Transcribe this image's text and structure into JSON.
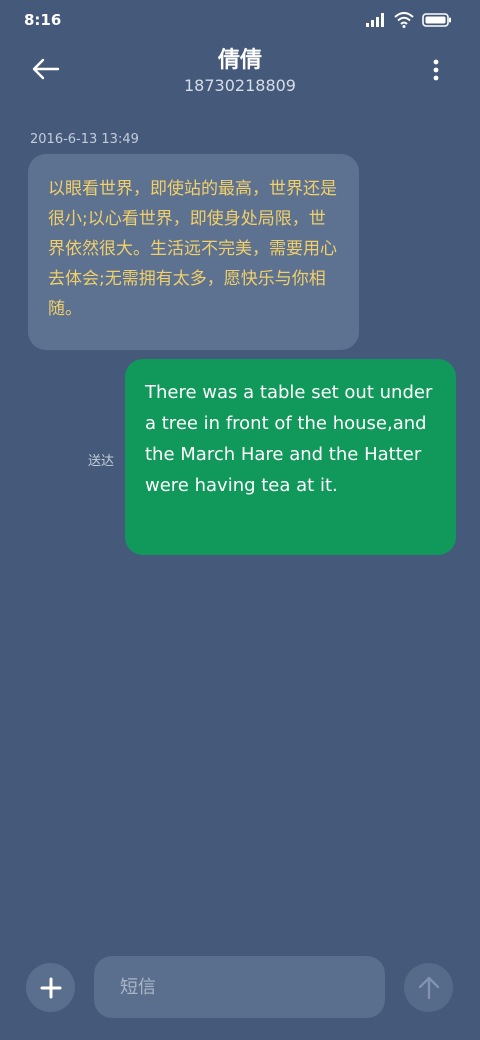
{
  "status_bar": {
    "time": "8:16",
    "icons": [
      "signal-icon",
      "wifi-icon",
      "battery-icon"
    ]
  },
  "header": {
    "back_icon": "back-arrow-icon",
    "contact_name": "倩倩",
    "contact_number": "18730218809",
    "menu_icon": "more-vertical-icon"
  },
  "conversation": {
    "timestamp": "2016-6-13 13:49",
    "incoming_message": "以眼看世界，即使站的最高，世界还是很小;以心看世界，即使身处局限，世界依然很大。生活远不完美，需要用心去体会;无需拥有太多，愿快乐与你相随。",
    "outgoing_message": "There was a table set out under a tree in front of the house,and the March Hare and the Hatter were having tea at it.",
    "outgoing_status": "送达"
  },
  "composer": {
    "add_icon": "plus-icon",
    "input_placeholder": "短信",
    "send_icon": "send-arrow-icon"
  },
  "colors": {
    "background": "#455a7a",
    "incoming_bubble": "#5d7191",
    "incoming_text": "#f1d06a",
    "outgoing_bubble": "#10995a",
    "outgoing_text": "#ffffff"
  }
}
